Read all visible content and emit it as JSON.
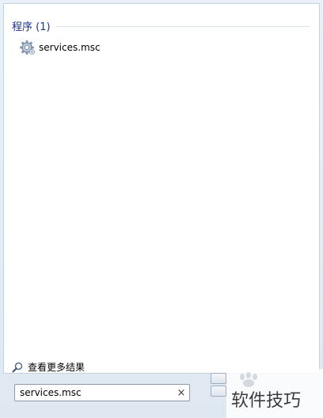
{
  "results": {
    "section_title": "程序 (1)",
    "items": [
      {
        "label": "services.msc",
        "icon": "gear-icon"
      }
    ],
    "more_label": "查看更多结果"
  },
  "search": {
    "value": "services.msc",
    "clear_symbol": "×"
  },
  "watermark": {
    "text": "软件技巧"
  },
  "colors": {
    "section_title": "#1e3287",
    "pane_background": "#ffffff",
    "menu_background": "#dfe8f1"
  }
}
